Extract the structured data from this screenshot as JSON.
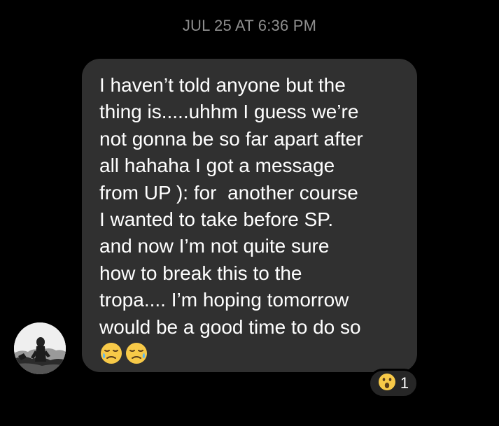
{
  "header": {
    "timestamp": "JUL 25 AT 6:36 PM"
  },
  "message": {
    "text": "I haven’t told anyone but the\nthing is.....uhhm I guess we’re\nnot gonna be so far apart after\nall hahaha I got a message\nfrom UP ): for  another course\nI wanted to take before SP.\nand now I’m not quite sure\nhow to break this to the\ntropa.... I’m hoping tomorrow\nwould be a good time to do so",
    "emojis": [
      "sad-relieved-face-icon",
      "sad-relieved-face-icon"
    ]
  },
  "reaction": {
    "emoji": "astonished-face-icon",
    "count": "1"
  },
  "colors": {
    "background": "#000000",
    "bubble": "#303030",
    "timestamp": "#8e8e8e",
    "text": "#ffffff"
  }
}
